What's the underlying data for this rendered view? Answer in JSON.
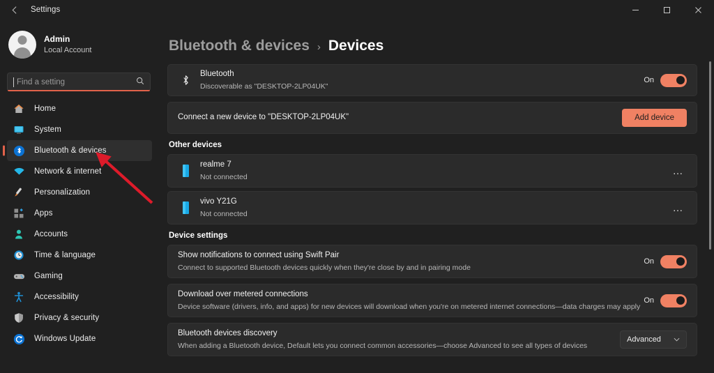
{
  "titlebar": {
    "back_label": "←",
    "app_title": "Settings",
    "minimize_label": "minimize-icon",
    "maximize_label": "maximize-icon",
    "close_label": "close-icon"
  },
  "sidebar": {
    "account": {
      "name": "Admin",
      "type": "Local Account",
      "avatar_icon": "person-avatar-icon"
    },
    "search": {
      "placeholder": "Find a setting",
      "value": "",
      "icon": "search-icon"
    },
    "items": [
      {
        "label": "Home",
        "icon": "home-icon",
        "active": false
      },
      {
        "label": "System",
        "icon": "monitor-icon",
        "active": false
      },
      {
        "label": "Bluetooth & devices",
        "icon": "bluetooth-icon",
        "active": true
      },
      {
        "label": "Network & internet",
        "icon": "wifi-icon",
        "active": false
      },
      {
        "label": "Personalization",
        "icon": "paintbrush-icon",
        "active": false
      },
      {
        "label": "Apps",
        "icon": "apps-grid-icon",
        "active": false
      },
      {
        "label": "Accounts",
        "icon": "person-icon",
        "active": false
      },
      {
        "label": "Time & language",
        "icon": "clock-icon",
        "active": false
      },
      {
        "label": "Gaming",
        "icon": "gamepad-icon",
        "active": false
      },
      {
        "label": "Accessibility",
        "icon": "accessibility-icon",
        "active": false
      },
      {
        "label": "Privacy & security",
        "icon": "shield-icon",
        "active": false
      },
      {
        "label": "Windows Update",
        "icon": "update-refresh-icon",
        "active": false
      }
    ]
  },
  "breadcrumb": {
    "parent": "Bluetooth & devices",
    "separator": "›",
    "current": "Devices"
  },
  "bluetooth_card": {
    "icon": "bluetooth-icon",
    "title": "Bluetooth",
    "subtitle": "Discoverable as \"DESKTOP-2LP04UK\"",
    "toggle_state": "On",
    "toggle_on": true
  },
  "add_device_card": {
    "text": "Connect a new device to \"DESKTOP-2LP04UK\"",
    "button_label": "Add device"
  },
  "other_devices": {
    "section_label": "Other devices",
    "devices": [
      {
        "name": "realme 7",
        "status": "Not connected",
        "icon": "phone-icon",
        "menu": "…"
      },
      {
        "name": "vivo Y21G",
        "status": "Not connected",
        "icon": "phone-icon",
        "menu": "…"
      }
    ]
  },
  "device_settings": {
    "section_label": "Device settings",
    "rows": [
      {
        "title": "Show notifications to connect using Swift Pair",
        "subtitle": "Connect to supported Bluetooth devices quickly when they're close by and in pairing mode",
        "control": "toggle",
        "toggle_state": "On"
      },
      {
        "title": "Download over metered connections",
        "subtitle": "Device software (drivers, info, and apps) for new devices will download when you're on metered internet connections—data charges may apply",
        "control": "toggle",
        "toggle_state": "On"
      },
      {
        "title": "Bluetooth devices discovery",
        "subtitle": "When adding a Bluetooth device, Default lets you connect common accessories—choose Advanced to see all types of devices",
        "control": "select",
        "select_value": "Advanced"
      }
    ]
  },
  "annotation": {
    "type": "arrow",
    "color": "#dd1b2a",
    "points_to": "sidebar-item-bluetooth-devices"
  },
  "colors": {
    "page_bg": "#202020",
    "card_bg": "#2b2b2b",
    "accent": "#f08163",
    "selection_bar": "#e2624a",
    "annotation_red": "#dd1b2a"
  }
}
